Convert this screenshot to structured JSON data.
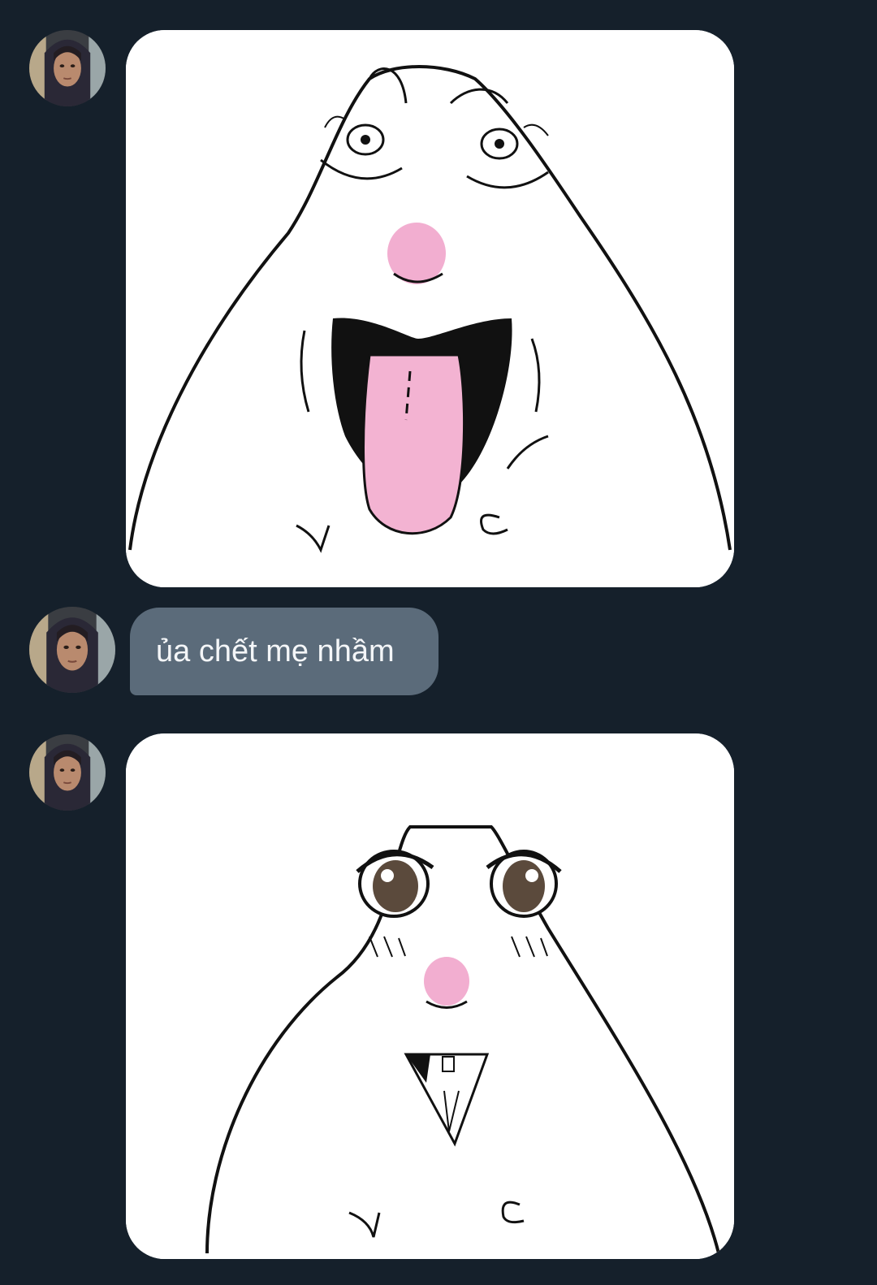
{
  "colors": {
    "background": "#15202b",
    "received_bubble": "#5b6b7a",
    "bubble_text": "#f4f6f8",
    "blush": "#f2aed0",
    "tongue": "#f3b3d2"
  },
  "conversation": {
    "messages": [
      {
        "type": "image",
        "sender_avatar": "avatar-photo",
        "content": "meme-face-tongue-out-drawing"
      },
      {
        "type": "text",
        "sender_avatar": "avatar-photo",
        "text": "ủa chết mẹ nhầm"
      },
      {
        "type": "image",
        "sender_avatar": "avatar-photo",
        "content": "meme-face-shy-drawing"
      }
    ]
  }
}
